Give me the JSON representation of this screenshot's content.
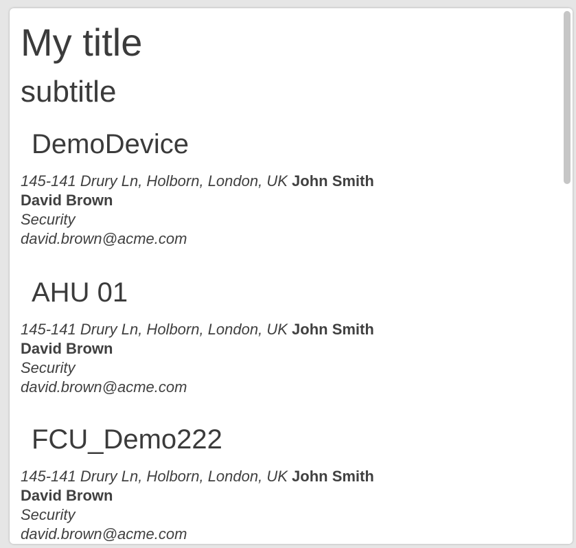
{
  "header": {
    "title": "My title",
    "subtitle": "subtitle"
  },
  "devices": [
    {
      "name": "DemoDevice",
      "address": "145-141 Drury Ln, Holborn, London, UK",
      "owner": "John Smith",
      "contact_name": "David Brown",
      "department": "Security",
      "email": "david.brown@acme.com"
    },
    {
      "name": "AHU 01",
      "address": "145-141 Drury Ln, Holborn, London, UK",
      "owner": "John Smith",
      "contact_name": "David Brown",
      "department": "Security",
      "email": "david.brown@acme.com"
    },
    {
      "name": "FCU_Demo222",
      "address": "145-141 Drury Ln, Holborn, London, UK",
      "owner": "John Smith",
      "contact_name": "David Brown",
      "department": "Security",
      "email": "david.brown@acme.com"
    }
  ]
}
